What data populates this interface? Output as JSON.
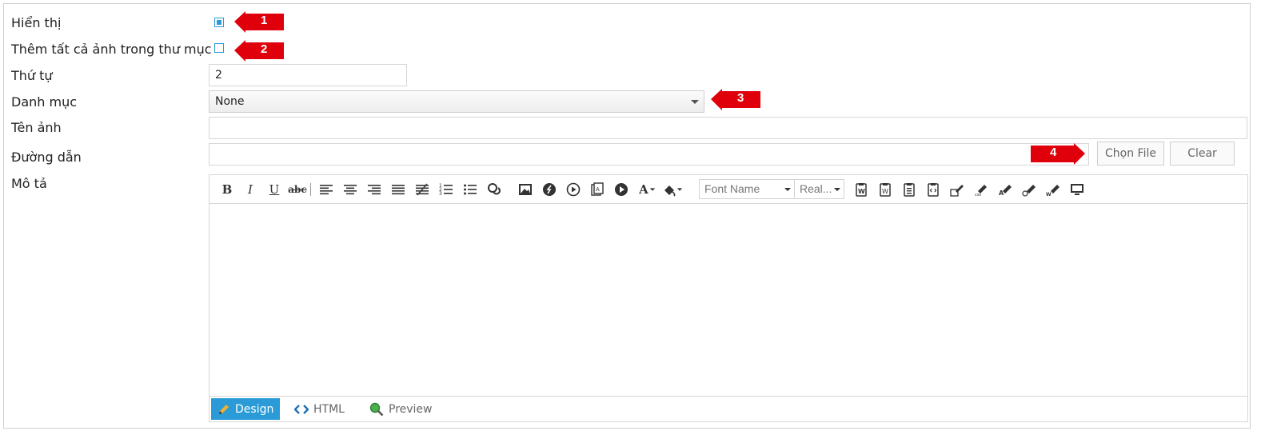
{
  "form": {
    "hien_thi_label": "Hiển thị",
    "hien_thi_checked": true,
    "them_tat_ca_label": "Thêm tất cả ảnh trong thư mục",
    "them_tat_ca_checked": false,
    "thu_tu_label": "Thứ tự",
    "thu_tu_value": "2",
    "danh_muc_label": "Danh mục",
    "danh_muc_value": "None",
    "ten_anh_label": "Tên ảnh",
    "ten_anh_value": "",
    "duong_dan_label": "Đường dẫn",
    "duong_dan_value": "",
    "chon_file_label": "Chọn File",
    "clear_label": "Clear",
    "mo_ta_label": "Mô tả"
  },
  "editor": {
    "font_name_placeholder": "Font Name",
    "font_size_placeholder": "Real...",
    "modes": {
      "design": "Design",
      "html": "HTML",
      "preview": "Preview"
    },
    "active_mode": "design"
  },
  "annotations": {
    "a1": "1",
    "a2": "2",
    "a3": "3",
    "a4": "4"
  },
  "colors": {
    "accent": "#2a9bd6",
    "annotation": "#e0000b"
  }
}
